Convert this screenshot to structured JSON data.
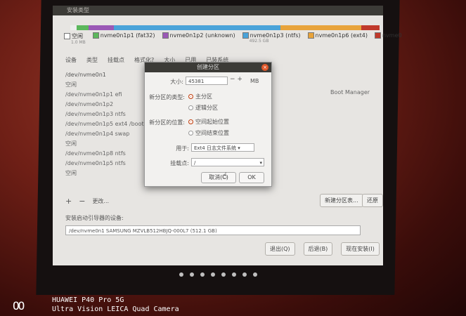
{
  "window": {
    "title": "安装类型"
  },
  "partition_legend": [
    {
      "label": "空闲",
      "sub": "1.0 MB",
      "color": "#ffffff"
    },
    {
      "label": "nvme0n1p1 (fat32)",
      "sub": "",
      "color": "#5cb85c"
    },
    {
      "label": "nvme0n1p2 (unknown)",
      "sub": "",
      "color": "#9b59b6"
    },
    {
      "label": "nvme0n1p3 (ntfs)",
      "sub": "492.5 GB",
      "color": "#4aa3d9"
    },
    {
      "label": "nvme0n1p6 (ext4)",
      "sub": "",
      "color": "#e8a33a"
    },
    {
      "label": "nvme0",
      "sub": "",
      "color": "#c0392b"
    }
  ],
  "table": {
    "headers": [
      "设备",
      "类型",
      "挂载点",
      "格式化?",
      "大小",
      "已用",
      "已装系统"
    ],
    "rows": [
      {
        "text": "/dev/nvme0n1",
        "type": "dev"
      },
      {
        "text": "空闲",
        "type": "part"
      },
      {
        "text": "/dev/nvme0n1p1 efi",
        "type": "part"
      },
      {
        "text": "/dev/nvme0n1p2",
        "type": "part"
      },
      {
        "text": "/dev/nvme0n1p3 ntfs",
        "type": "part"
      },
      {
        "text": "/dev/nvme0n1p5 ext4 /boot",
        "type": "part"
      },
      {
        "text": "/dev/nvme0n1p4 swap",
        "type": "part"
      },
      {
        "text": "空闲",
        "type": "part"
      },
      {
        "text": "/dev/nvme0n1p8 ntfs",
        "type": "part"
      },
      {
        "text": "/dev/nvme0n1p5 ntfs",
        "type": "part"
      },
      {
        "text": "空闲",
        "type": "part"
      }
    ],
    "right_label": "Boot Manager"
  },
  "table_tools": {
    "add": "+",
    "remove": "−",
    "change": "更改..."
  },
  "buttons": {
    "new_table": "新建分区表...",
    "revert": "还原",
    "quit": "退出(Q)",
    "back": "后退(B)",
    "install": "现在安装(I)"
  },
  "bootloader": {
    "label": "安装启动引导器的设备:",
    "value": "/dev/nvme0n1    SAMSUNG MZVLB512HBJQ-000L7 (512.1 GB)"
  },
  "dialog": {
    "title": "创建分区",
    "close_icon": "×",
    "size_label": "大小:",
    "size_value": "45381",
    "size_unit": "MB",
    "type_label": "新分区的类型:",
    "type_primary": "主分区",
    "type_logical": "逻辑分区",
    "location_label": "新分区的位置:",
    "location_start": "空间起始位置",
    "location_end": "空间结束位置",
    "use_as_label": "用于:",
    "use_as_value": "Ext4 日志文件系统",
    "mount_label": "挂载点:",
    "mount_value": "/",
    "cancel": "取消(C)",
    "ok": "OK"
  },
  "watermark": {
    "logo": "OO",
    "line1": "HUAWEI P40 Pro 5G",
    "line2": "Ultra Vision LEICA Quad Camera"
  },
  "dock": {
    "count": 8
  }
}
